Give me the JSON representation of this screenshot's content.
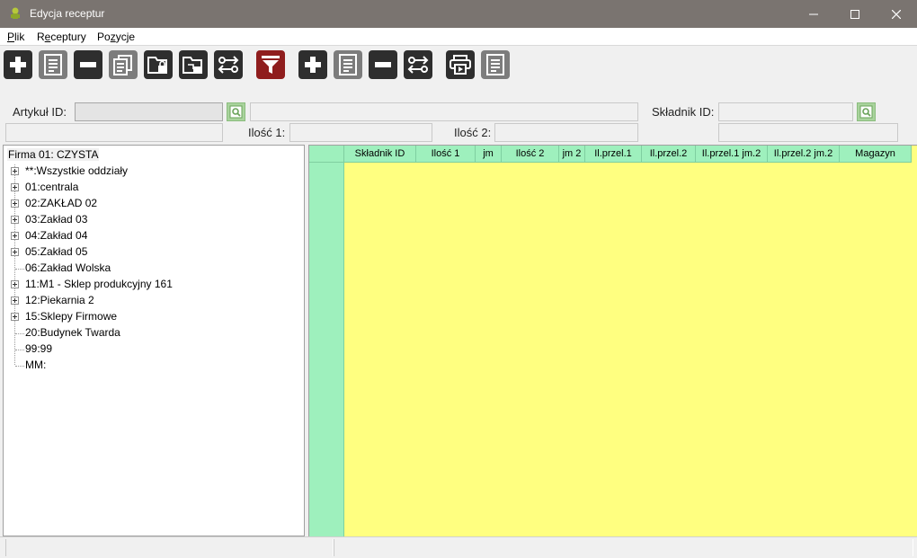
{
  "window": {
    "title": "Edycja receptur"
  },
  "menu": {
    "plik": {
      "accel": "P",
      "rest": "lik"
    },
    "receptury": {
      "pre": "R",
      "accel": "e",
      "rest": "ceptury"
    },
    "pozycje": {
      "pre": "Po",
      "accel": "z",
      "rest": "ycje"
    }
  },
  "toolbar_icons": [
    "add-icon",
    "edit-icon",
    "remove-icon",
    "copy-icon",
    "lock-folder-icon",
    "lock-folder-alt-icon",
    "swap-icon",
    "filter-icon",
    "add-icon",
    "edit-icon",
    "remove-icon",
    "swap-icon",
    "print-icon",
    "report-icon"
  ],
  "form": {
    "artykul_label": "Artykuł ID:",
    "ilosc1_label": "Ilość 1:",
    "ilosc2_label": "Ilość 2:",
    "skladnik_label": "Składnik ID:"
  },
  "tree": {
    "root": "Firma 01: CZYSTA",
    "items": [
      {
        "label": "**:Wszystkie oddziały",
        "expandable": true
      },
      {
        "label": "01:centrala",
        "expandable": true
      },
      {
        "label": "02:ZAKŁAD 02",
        "expandable": true
      },
      {
        "label": "03:Zakład 03",
        "expandable": true
      },
      {
        "label": "04:Zakład 04",
        "expandable": true
      },
      {
        "label": "05:Zakład 05",
        "expandable": true
      },
      {
        "label": "06:Zakład  Wolska",
        "expandable": false
      },
      {
        "label": "11:M1 - Sklep produkcyjny 161",
        "expandable": true
      },
      {
        "label": "12:Piekarnia 2",
        "expandable": true
      },
      {
        "label": "15:Sklepy Firmowe",
        "expandable": true
      },
      {
        "label": "20:Budynek Twarda",
        "expandable": false
      },
      {
        "label": "99:99",
        "expandable": false
      },
      {
        "label": "MM:",
        "expandable": false
      }
    ]
  },
  "grid": {
    "columns": [
      "Składnik ID",
      "Ilość 1",
      "jm",
      "Ilość 2",
      "jm 2",
      "Il.przel.1",
      "Il.przel.2",
      "Il.przel.1 jm.2",
      "Il.przel.2 jm.2",
      "Magazyn"
    ]
  },
  "colors": {
    "titlebar": "#7a7470",
    "grid_body": "#ffff80",
    "grid_header": "#9ef0bd",
    "filter_button": "#8f1d1d"
  }
}
